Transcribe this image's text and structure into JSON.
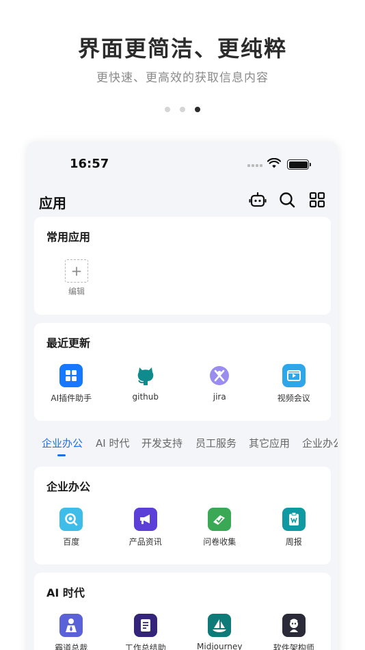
{
  "hero": {
    "title": "界面更简洁、更纯粹",
    "subtitle": "更快速、更高效的获取信息内容",
    "pager": {
      "count": 3,
      "active_index": 2
    }
  },
  "status_bar": {
    "time": "16:57"
  },
  "app_bar": {
    "title": "应用",
    "icons": [
      "robot-icon",
      "search-icon",
      "grid-icon"
    ]
  },
  "common_apps": {
    "title": "常用应用",
    "edit_label": "编辑"
  },
  "recent_updates": {
    "title": "最近更新",
    "apps": [
      {
        "label": "AI插件助手",
        "icon": "four-squares-icon",
        "color": "#1677ff"
      },
      {
        "label": "github",
        "icon": "github-icon",
        "color": "#0f8b8d"
      },
      {
        "label": "jira",
        "icon": "jira-icon",
        "color": "#9b8cf0"
      },
      {
        "label": "视频会议",
        "icon": "video-icon",
        "color": "#2ea7ea"
      }
    ]
  },
  "tabs": {
    "items": [
      "企业办公",
      "AI 时代",
      "开发支持",
      "员工服务",
      "其它应用",
      "企业办公"
    ],
    "active_index": 0,
    "accent": "#1f6fe8"
  },
  "section_office": {
    "title": "企业办公",
    "apps": [
      {
        "label": "百度",
        "icon": "baidu-search-icon",
        "color": "#3dbde8"
      },
      {
        "label": "产品资讯",
        "icon": "megaphone-icon",
        "color": "#5b3fd6"
      },
      {
        "label": "问卷收集",
        "icon": "survey-icon",
        "color": "#3aa855"
      },
      {
        "label": "周报",
        "icon": "clipboard-icon",
        "color": "#0f9aa3"
      }
    ]
  },
  "section_ai": {
    "title": "AI 时代",
    "apps": [
      {
        "label": "霸道总裁",
        "icon": "president-icon",
        "color": "#5b62d9"
      },
      {
        "label": "工作总结助",
        "icon": "notebook-icon",
        "color": "#34257a"
      },
      {
        "label": "Midjourney",
        "icon": "sailboat-icon",
        "color": "#0e7b78"
      },
      {
        "label": "软件架构师",
        "icon": "architect-icon",
        "color": "#2a2a38"
      }
    ]
  }
}
